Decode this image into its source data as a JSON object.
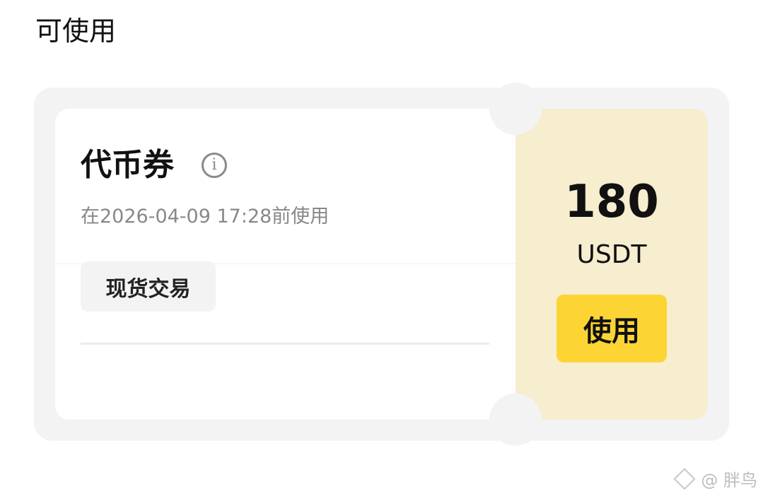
{
  "section": {
    "title": "可使用"
  },
  "coupon": {
    "name": "代币券",
    "info_icon": "info-icon",
    "expiry": "在2026-04-09 17:28前使用",
    "tag": "现货交易",
    "amount": "180",
    "unit": "USDT",
    "use_button_label": "使用"
  },
  "watermark": {
    "text": "@ 胖鸟"
  },
  "colors": {
    "accent_button": "#fcd535",
    "amount_panel": "#f7edcf",
    "card_background": "#f3f3f3"
  }
}
